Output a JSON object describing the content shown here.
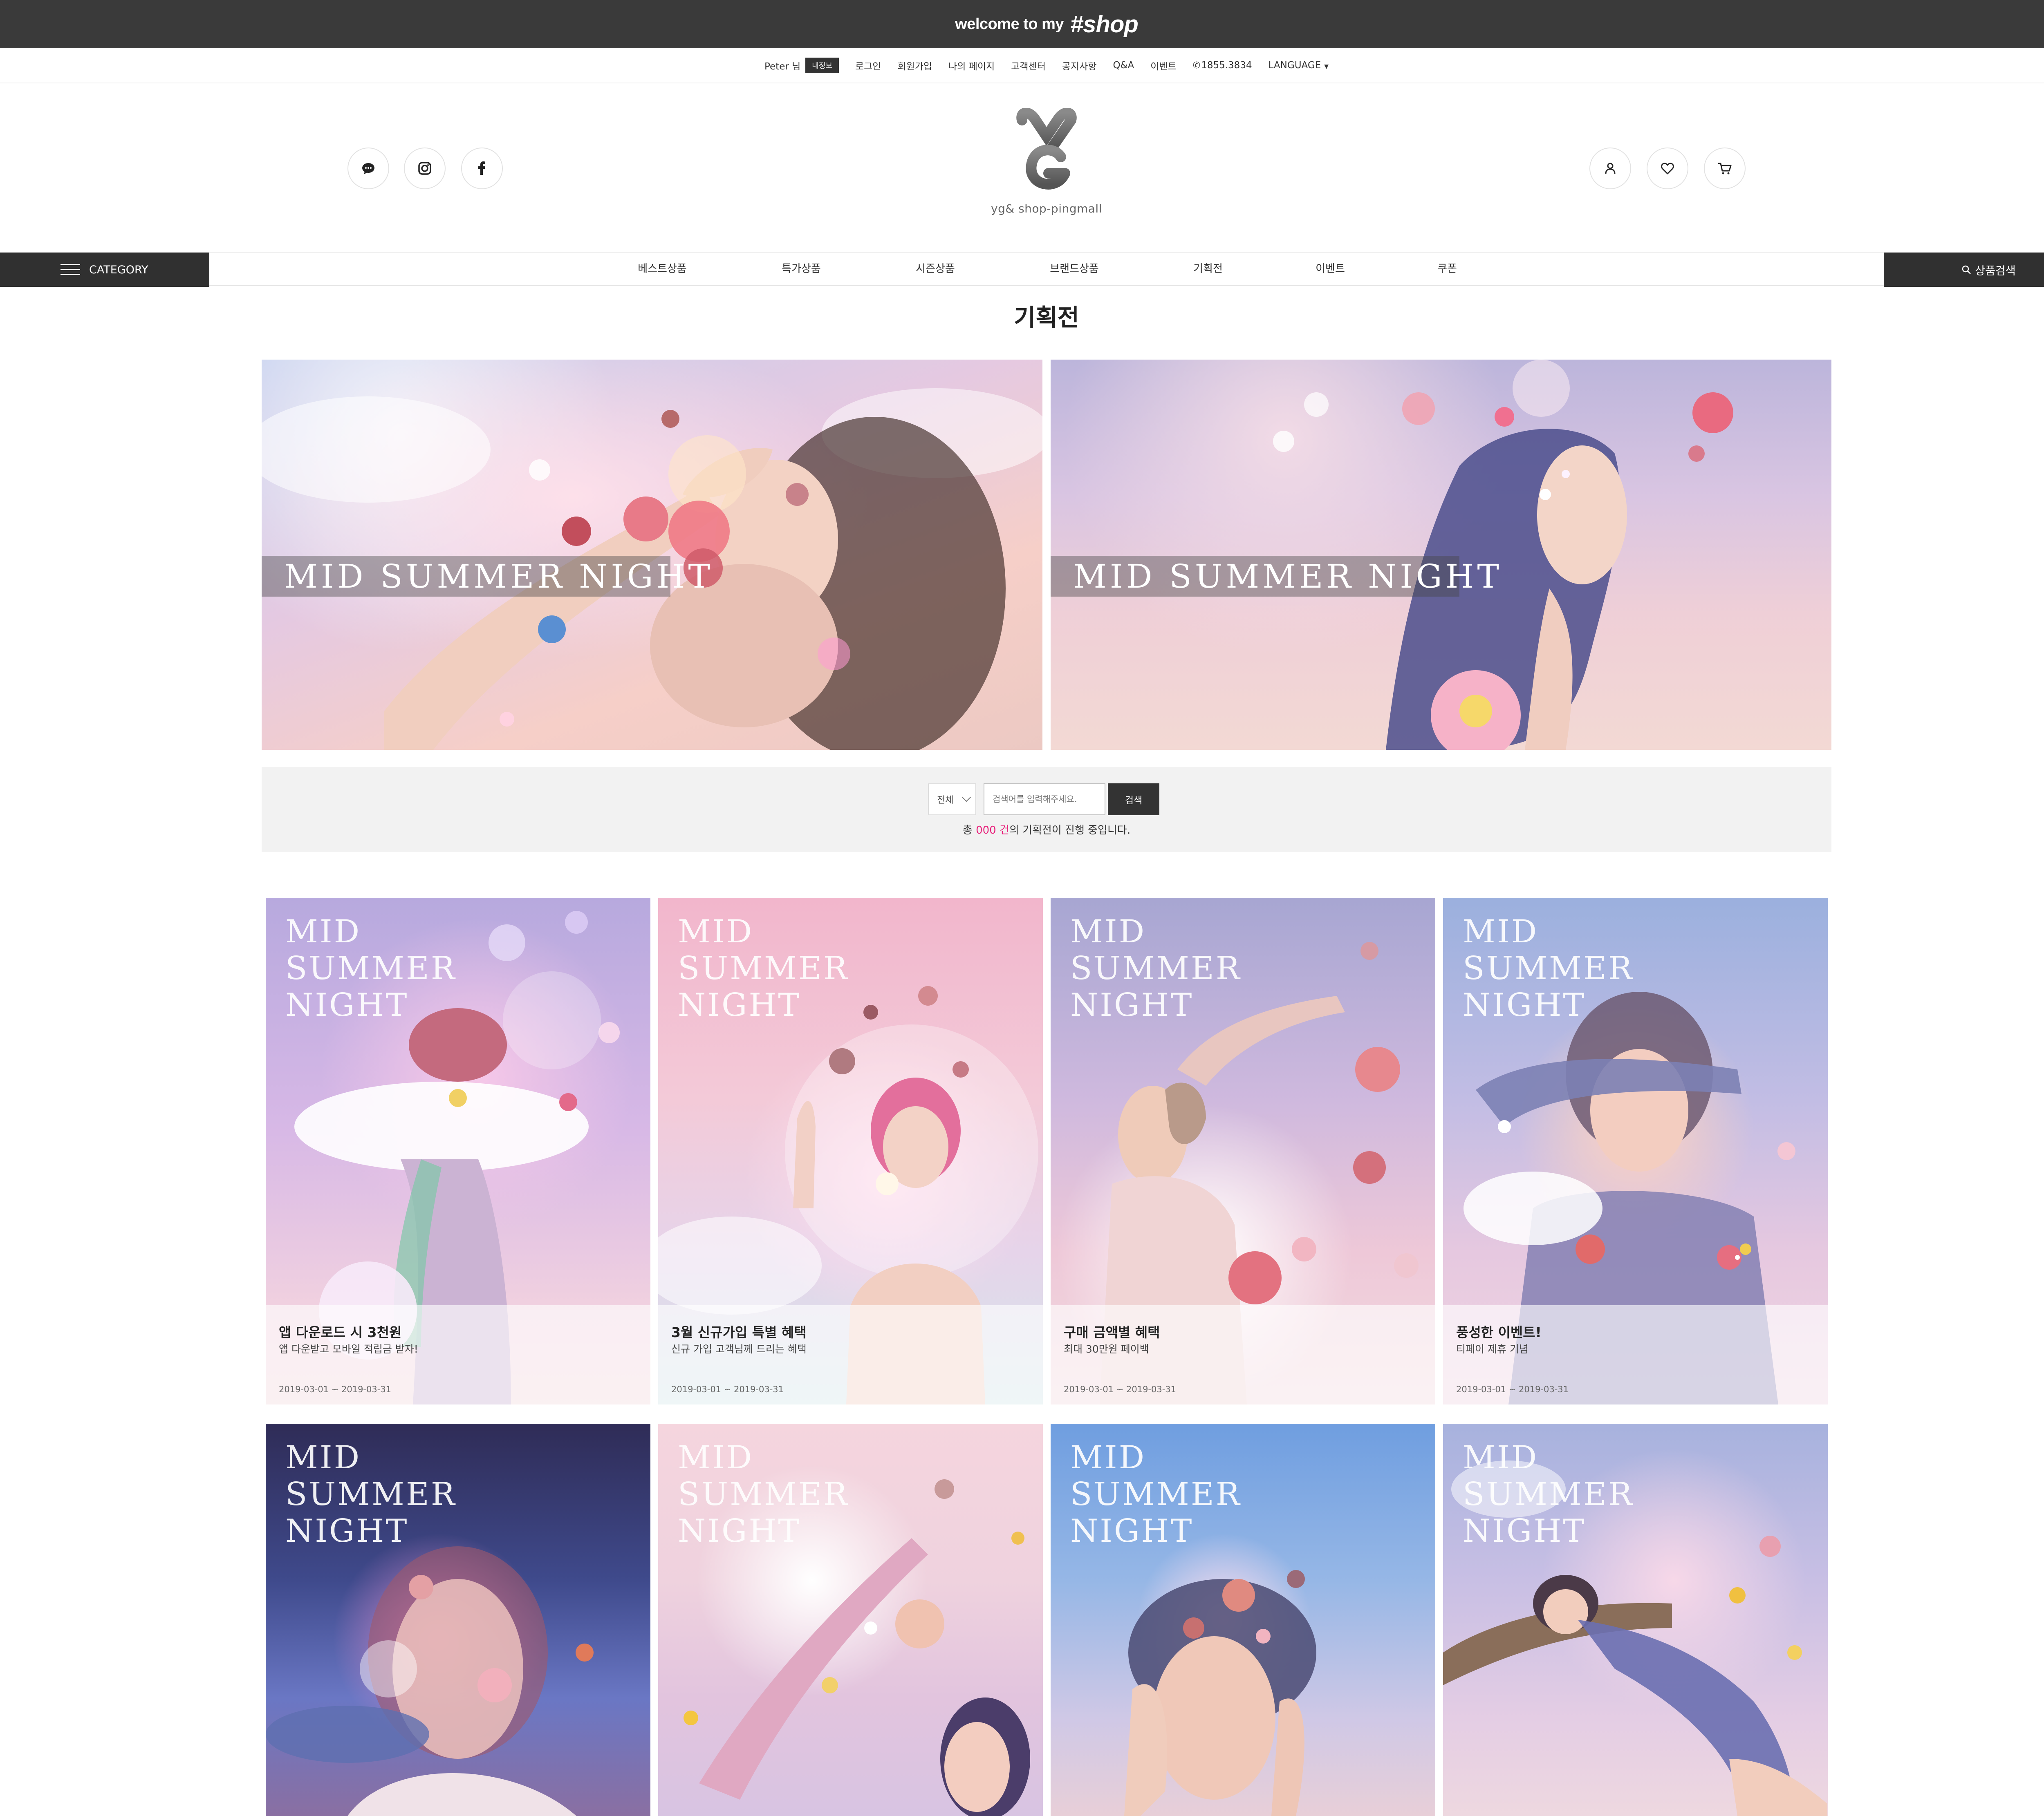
{
  "topbar": {
    "welcome": "welcome to my",
    "shop": "#shop"
  },
  "util": {
    "user": "Peter 님",
    "badge": "내정보",
    "links": [
      "로그인",
      "회원가입",
      "나의 페이지",
      "고객센터",
      "공지사항",
      "Q&A",
      "이벤트"
    ],
    "phone": "1855.3834",
    "language": "LANGUAGE"
  },
  "header": {
    "logo_tag": "yg& shop-pingmall",
    "social": [
      "talk-icon",
      "instagram-icon",
      "facebook-icon"
    ],
    "user_icons": [
      "user-icon",
      "heart-icon",
      "cart-icon"
    ]
  },
  "nav": {
    "category": "CATEGORY",
    "items": [
      "베스트상품",
      "특가상품",
      "시즌상품",
      "브랜드상품",
      "기획전",
      "이벤트",
      "쿠폰"
    ],
    "search": "상품검색"
  },
  "page_title": "기획전",
  "banners": [
    {
      "text": "MID SUMMER NIGHT"
    },
    {
      "text": "MID SUMMER NIGHT"
    }
  ],
  "search": {
    "select": "전체",
    "placeholder": "검색어를 입력해주세요.",
    "button": "검색",
    "count_pre": "총 ",
    "count": "000 건",
    "count_post": "의 기획전이 진행 중입니다."
  },
  "cards": [
    {
      "art": "MID SUMMER NIGHT",
      "title": "앱 다운로드 시 3천원",
      "sub": "앱 다운받고 모바일 적립금 받자!",
      "date": "2019-03-01 ~ 2019-03-31"
    },
    {
      "art": "MID SUMMER NIGHT",
      "title": "3월 신규가입 특별 혜택",
      "sub": "신규 가입 고객님께 드리는 혜택",
      "date": "2019-03-01 ~ 2019-03-31"
    },
    {
      "art": "MID SUMMER NIGHT",
      "title": "구매 금액별 혜택",
      "sub": "최대 30만원 페이백",
      "date": "2019-03-01 ~ 2019-03-31"
    },
    {
      "art": "MID SUMMER NIGHT",
      "title": "풍성한 이벤트!",
      "sub": "티페이 제휴 기념",
      "date": "2019-03-01 ~ 2019-03-31"
    },
    {
      "art": "MID SUMMER NIGHT"
    },
    {
      "art": "MID SUMMER NIGHT"
    },
    {
      "art": "MID SUMMER NIGHT"
    },
    {
      "art": "MID SUMMER NIGHT"
    }
  ],
  "colors": {
    "dark": "#303030",
    "accent": "#e8207a",
    "panel": "#f2f2f2"
  }
}
